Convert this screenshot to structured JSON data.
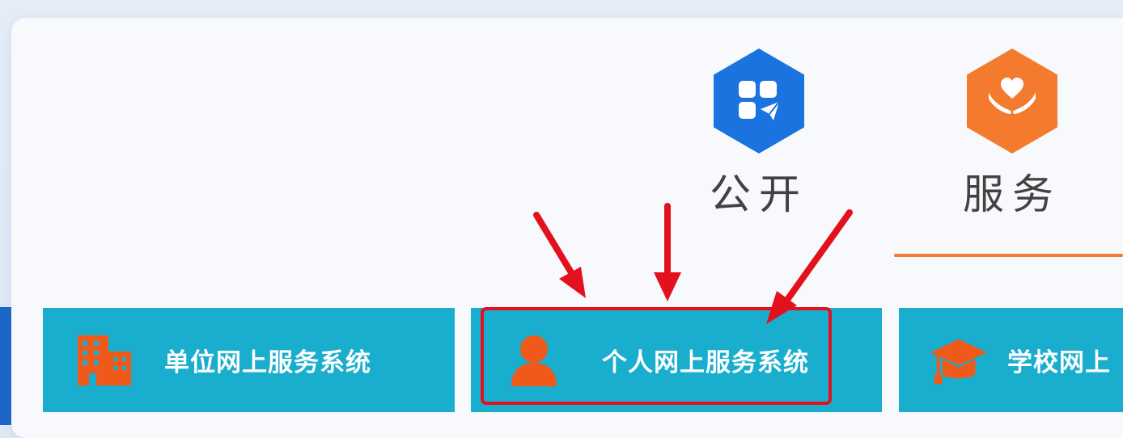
{
  "nav": {
    "items": [
      {
        "label": "公开",
        "icon": "app-grid-paper-plane-icon",
        "color": "#1a73df"
      },
      {
        "label": "服务",
        "icon": "heart-hands-icon",
        "color": "#f47b2d",
        "active": true
      }
    ]
  },
  "systems": [
    {
      "label": "单位网上服务系统",
      "icon": "building-icon"
    },
    {
      "label": "个人网上服务系统",
      "icon": "person-icon",
      "highlighted": true
    },
    {
      "label": "学校网上",
      "icon": "graduation-cap-icon"
    }
  ],
  "colors": {
    "button_bg": "#19aecd",
    "icon_orange": "#ef5a1b",
    "highlight_red": "#e3101d",
    "active_line": "#ef7d2d"
  }
}
